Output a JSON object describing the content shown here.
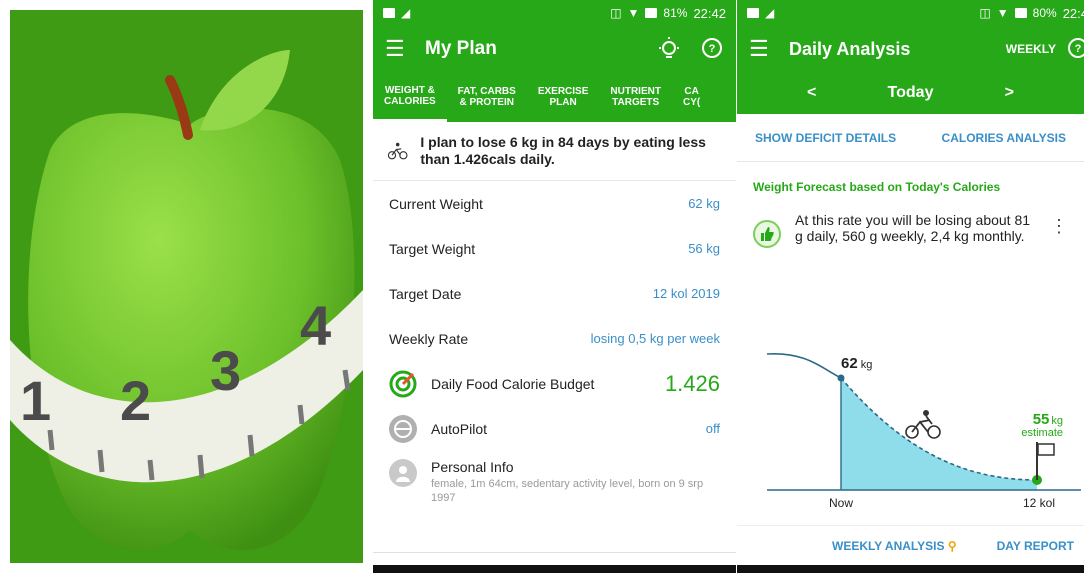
{
  "colors": {
    "brand_green": "#27a818",
    "link_blue": "#3a8fc8",
    "chart_fill": "#8fdcea",
    "text": "#222222"
  },
  "logo": {
    "ruler_digits": [
      "1",
      "2",
      "3",
      "4"
    ]
  },
  "my_plan": {
    "status": {
      "battery": "81%",
      "time": "22:42"
    },
    "title": "My Plan",
    "tabs": [
      {
        "label": "WEIGHT &\nCALORIES"
      },
      {
        "label": "FAT, CARBS\n& PROTEIN"
      },
      {
        "label": "EXERCISE\nPLAN"
      },
      {
        "label": "NUTRIENT\nTARGETS"
      },
      {
        "label": "CA\nCY("
      }
    ],
    "intro": "I plan to lose 6 kg in 84 days by eating less than  1.426cals  daily.",
    "rows": [
      {
        "label": "Current Weight",
        "value": "62 kg"
      },
      {
        "label": "Target Weight",
        "value": "56 kg"
      },
      {
        "label": "Target Date",
        "value": "12 kol 2019"
      },
      {
        "label": "Weekly Rate",
        "value": "losing 0,5 kg per week"
      }
    ],
    "budget": {
      "label": "Daily Food Calorie Budget",
      "value": "1.426"
    },
    "autopilot": {
      "label": "AutoPilot",
      "value": "off"
    },
    "personal": {
      "label": "Personal Info",
      "detail": "female, 1m 64cm, sedentary activity level, born on 9 srp 1997"
    }
  },
  "analysis": {
    "status": {
      "battery": "80%",
      "time": "22:4"
    },
    "title": "Daily Analysis",
    "weekly": "WEEKLY",
    "date": "Today",
    "prev": "<",
    "next": ">",
    "link_deficit": "SHOW DEFICIT DETAILS",
    "link_calories": "CALORIES ANALYSIS",
    "forecast_title": "Weight Forecast based on Today's Calories",
    "forecast_text": "At this rate you will be losing about 81 g daily, 560 g weekly, 2,4 kg monthly.",
    "more": "⋮",
    "chart_labels": {
      "start_value": "62",
      "start_unit": "kg",
      "end_value": "55",
      "end_unit": "kg",
      "estimate": "estimate",
      "x_start": "Now",
      "x_end": "12 kol"
    },
    "bottom_weekly": "WEEKLY ANALYSIS",
    "bottom_day": "DAY REPORT"
  },
  "chart_data": {
    "type": "area",
    "x": [
      "Now",
      "12 kol"
    ],
    "series": [
      {
        "values": [
          62,
          55
        ]
      }
    ],
    "title": "",
    "xlabel": "",
    "ylabel": ""
  }
}
